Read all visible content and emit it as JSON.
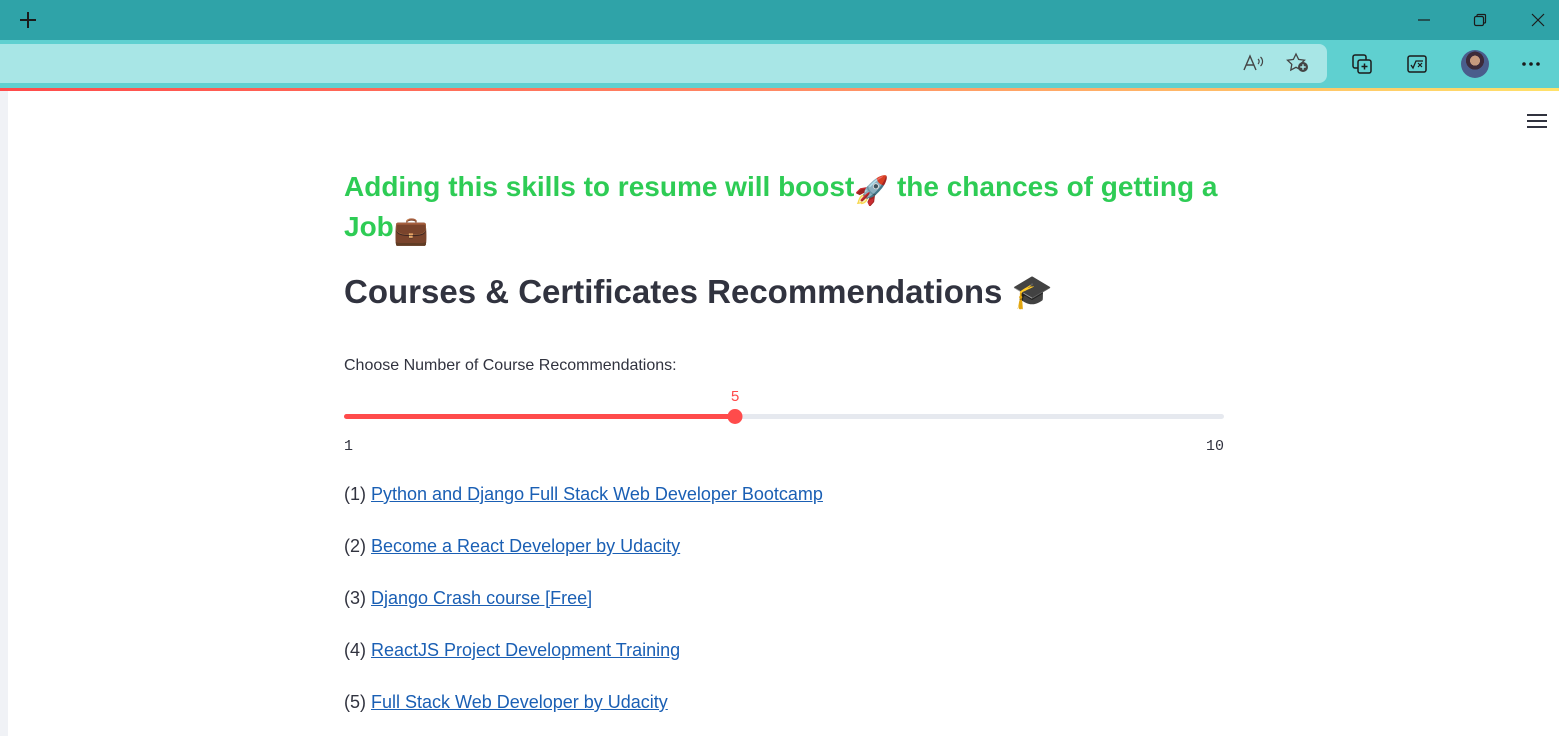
{
  "browser": {
    "toolbar_icons": [
      "read-aloud-icon",
      "add-favorite-icon",
      "collections-icon",
      "math-solver-icon",
      "profile-avatar",
      "more-icon"
    ],
    "window_controls": [
      "minimize-icon",
      "restore-icon",
      "close-icon"
    ]
  },
  "page": {
    "headline_part1": "Adding this skills to resume will boost",
    "headline_emoji1": "🚀",
    "headline_part2": " the chances of getting a Job",
    "headline_emoji2": "💼",
    "section_title": "Courses & Certificates Recommendations",
    "section_emoji": "🎓",
    "slider": {
      "label": "Choose Number of Course Recommendations:",
      "min": 1,
      "max": 10,
      "value": 5,
      "min_label": "1",
      "max_label": "10",
      "value_label": "5"
    },
    "courses": [
      {
        "index": "(1)",
        "title": "Python and Django Full Stack Web Developer Bootcamp"
      },
      {
        "index": "(2)",
        "title": "Become a React Developer by Udacity"
      },
      {
        "index": "(3)",
        "title": "Django Crash course [Free]"
      },
      {
        "index": "(4)",
        "title": "ReactJS Project Development Training"
      },
      {
        "index": "(5)",
        "title": "Full Stack Web Developer by Udacity"
      }
    ]
  },
  "colors": {
    "accent": "#ff4b4b",
    "headline": "#2ecc55",
    "link": "#1a5fb4",
    "titlebar": "#2fa3a8"
  }
}
